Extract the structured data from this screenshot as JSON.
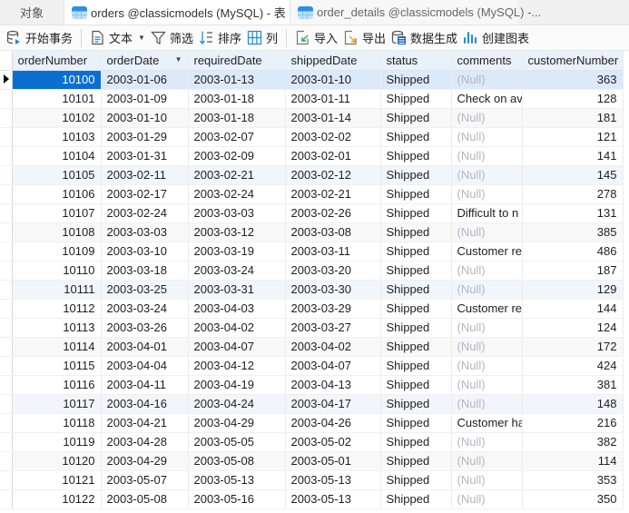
{
  "tabs": [
    {
      "label": "对象",
      "icon": "objects",
      "state": "plain"
    },
    {
      "label": "orders @classicmodels (MySQL) - 表",
      "icon": "table-icon",
      "state": "active"
    },
    {
      "label": "order_details @classicmodels (MySQL) -...",
      "icon": "table-icon",
      "state": "inactive"
    }
  ],
  "toolbar": {
    "begin_transaction": "开始事务",
    "text": "文本",
    "filter": "筛选",
    "sort": "排序",
    "columns": "列",
    "import": "导入",
    "export": "导出",
    "data_generation": "数据生成",
    "create_chart": "创建图表"
  },
  "grid": {
    "columns": [
      "orderNumber",
      "orderDate",
      "requiredDate",
      "shippedDate",
      "status",
      "comments",
      "customerNumber"
    ],
    "sorted_column": "orderDate",
    "selected_row": 0,
    "rows": [
      [
        "10100",
        "2003-01-06",
        "2003-01-13",
        "2003-01-10",
        "Shipped",
        "(Null)",
        "363"
      ],
      [
        "10101",
        "2003-01-09",
        "2003-01-18",
        "2003-01-11",
        "Shipped",
        "Check on av",
        "128"
      ],
      [
        "10102",
        "2003-01-10",
        "2003-01-18",
        "2003-01-14",
        "Shipped",
        "(Null)",
        "181"
      ],
      [
        "10103",
        "2003-01-29",
        "2003-02-07",
        "2003-02-02",
        "Shipped",
        "(Null)",
        "121"
      ],
      [
        "10104",
        "2003-01-31",
        "2003-02-09",
        "2003-02-01",
        "Shipped",
        "(Null)",
        "141"
      ],
      [
        "10105",
        "2003-02-11",
        "2003-02-21",
        "2003-02-12",
        "Shipped",
        "(Null)",
        "145"
      ],
      [
        "10106",
        "2003-02-17",
        "2003-02-24",
        "2003-02-21",
        "Shipped",
        "(Null)",
        "278"
      ],
      [
        "10107",
        "2003-02-24",
        "2003-03-03",
        "2003-02-26",
        "Shipped",
        "Difficult to n",
        "131"
      ],
      [
        "10108",
        "2003-03-03",
        "2003-03-12",
        "2003-03-08",
        "Shipped",
        "(Null)",
        "385"
      ],
      [
        "10109",
        "2003-03-10",
        "2003-03-19",
        "2003-03-11",
        "Shipped",
        "Customer re",
        "486"
      ],
      [
        "10110",
        "2003-03-18",
        "2003-03-24",
        "2003-03-20",
        "Shipped",
        "(Null)",
        "187"
      ],
      [
        "10111",
        "2003-03-25",
        "2003-03-31",
        "2003-03-30",
        "Shipped",
        "(Null)",
        "129"
      ],
      [
        "10112",
        "2003-03-24",
        "2003-04-03",
        "2003-03-29",
        "Shipped",
        "Customer re",
        "144"
      ],
      [
        "10113",
        "2003-03-26",
        "2003-04-02",
        "2003-03-27",
        "Shipped",
        "(Null)",
        "124"
      ],
      [
        "10114",
        "2003-04-01",
        "2003-04-07",
        "2003-04-02",
        "Shipped",
        "(Null)",
        "172"
      ],
      [
        "10115",
        "2003-04-04",
        "2003-04-12",
        "2003-04-07",
        "Shipped",
        "(Null)",
        "424"
      ],
      [
        "10116",
        "2003-04-11",
        "2003-04-19",
        "2003-04-13",
        "Shipped",
        "(Null)",
        "381"
      ],
      [
        "10117",
        "2003-04-16",
        "2003-04-24",
        "2003-04-17",
        "Shipped",
        "(Null)",
        "148"
      ],
      [
        "10118",
        "2003-04-21",
        "2003-04-29",
        "2003-04-26",
        "Shipped",
        "Customer ha",
        "216"
      ],
      [
        "10119",
        "2003-04-28",
        "2003-05-05",
        "2003-05-02",
        "Shipped",
        "(Null)",
        "382"
      ],
      [
        "10120",
        "2003-04-29",
        "2003-05-08",
        "2003-05-01",
        "Shipped",
        "(Null)",
        "114"
      ],
      [
        "10121",
        "2003-05-07",
        "2003-05-13",
        "2003-05-13",
        "Shipped",
        "(Null)",
        "353"
      ],
      [
        "10122",
        "2003-05-08",
        "2003-05-16",
        "2003-05-13",
        "Shipped",
        "(Null)",
        "350"
      ]
    ],
    "null_label": "(Null)"
  },
  "colors": {
    "accent": "#0a6fd0",
    "selected_row": "#dce9f8",
    "header_bg": "#e9f1fb",
    "null_text": "#b4b4c4"
  }
}
